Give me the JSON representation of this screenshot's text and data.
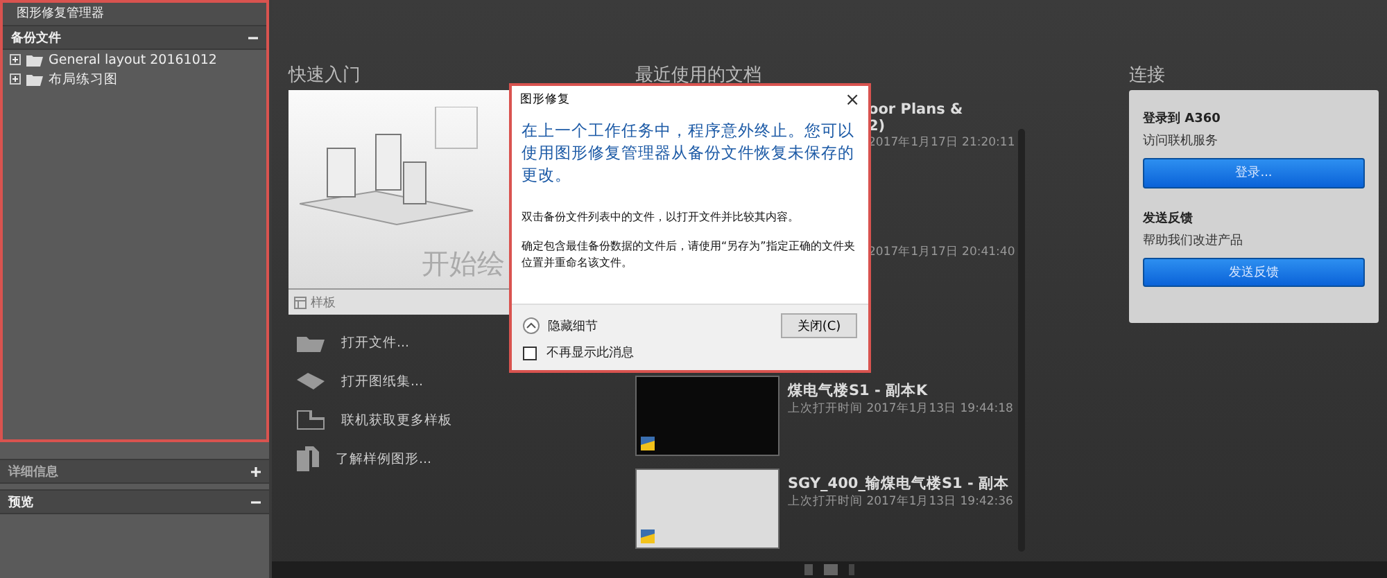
{
  "left_panel": {
    "title": "图形修复管理器",
    "backup_section": {
      "title": "备份文件",
      "expanded": true,
      "items": [
        {
          "label": "General layout 20161012",
          "expanded": false
        },
        {
          "label": "布局练习图",
          "expanded": false
        }
      ]
    },
    "sections": [
      {
        "title": "详细信息",
        "expanded": false
      },
      {
        "title": "预览",
        "expanded": true
      }
    ]
  },
  "quick_start": {
    "title": "快速入门",
    "card_caption": "开始绘",
    "template_label": "样板",
    "actions": [
      {
        "kind": "open-file",
        "label": "打开文件..."
      },
      {
        "kind": "sheet-set",
        "label": "打开图纸集..."
      },
      {
        "kind": "templates",
        "label": "联机获取更多样板"
      },
      {
        "kind": "samples",
        "label": "了解样例图形..."
      }
    ]
  },
  "recent_docs": {
    "title": "最近使用的文档",
    "items": [
      {
        "kind": "covered",
        "title_lines": [
          "oor Plans &",
          "2)"
        ],
        "time": "2017年1月17日 21:20:11"
      },
      {
        "kind": "covered",
        "time": "2017年1月17日 20:41:40"
      },
      {
        "kind": "dark",
        "title_lines": [
          "煤电气楼S1 - 副本K"
        ],
        "time": "上次打开时间 2017年1月13日 19:44:18"
      },
      {
        "kind": "light",
        "title_lines": [
          "SGY_400_输煤电气楼S1 - 副本"
        ],
        "time": "上次打开时间 2017年1月13日 19:42:36"
      }
    ]
  },
  "connect": {
    "title": "连接",
    "groups": [
      {
        "heading": "登录到 A360",
        "subtitle": "访问联机服务",
        "button": "登录..."
      },
      {
        "heading": "发送反馈",
        "subtitle": "帮助我们改进产品",
        "button": "发送反馈"
      }
    ]
  },
  "dialog": {
    "title": "图形修复",
    "close": "×",
    "instruction": "在上一个工作任务中，程序意外终止。您可以使用图形修复管理器从备份文件恢复未保存的更改。",
    "paragraphs": [
      "双击备份文件列表中的文件，以打开文件并比较其内容。",
      "确定包含最佳备份数据的文件后，请使用“另存为”指定正确的文件夹位置并重命名该文件。"
    ],
    "details_toggle": "隐藏细节",
    "details_expanded": true,
    "checkbox": {
      "label": "不再显示此消息",
      "checked": false
    },
    "button": "关闭(C)"
  }
}
